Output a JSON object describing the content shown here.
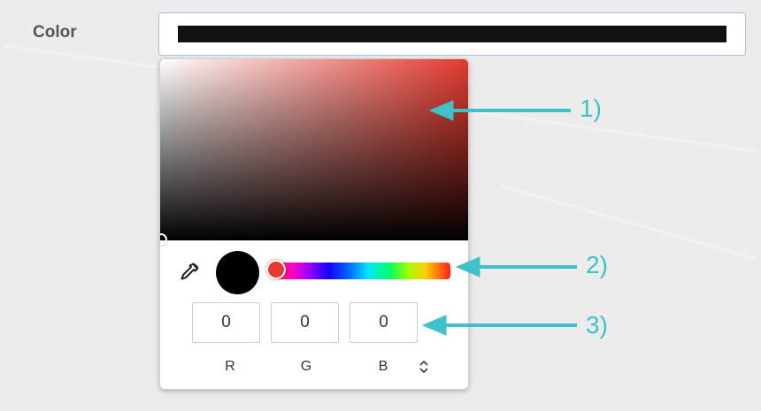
{
  "field": {
    "label": "Color",
    "value_color": "#111111"
  },
  "picker": {
    "base_hue_color": "#e53a2f",
    "current_color": "#000000",
    "icons": {
      "eyedropper": "eyedropper-icon",
      "toggle": "chevron-up-down-icon"
    },
    "rgb": [
      {
        "label": "R",
        "value": "0"
      },
      {
        "label": "G",
        "value": "0"
      },
      {
        "label": "B",
        "value": "0"
      }
    ]
  },
  "annotations": [
    {
      "label": "1)"
    },
    {
      "label": "2)"
    },
    {
      "label": "3)"
    }
  ],
  "colors": {
    "annotation": "#3fc1c9",
    "input_border": "#9fc3e6"
  }
}
